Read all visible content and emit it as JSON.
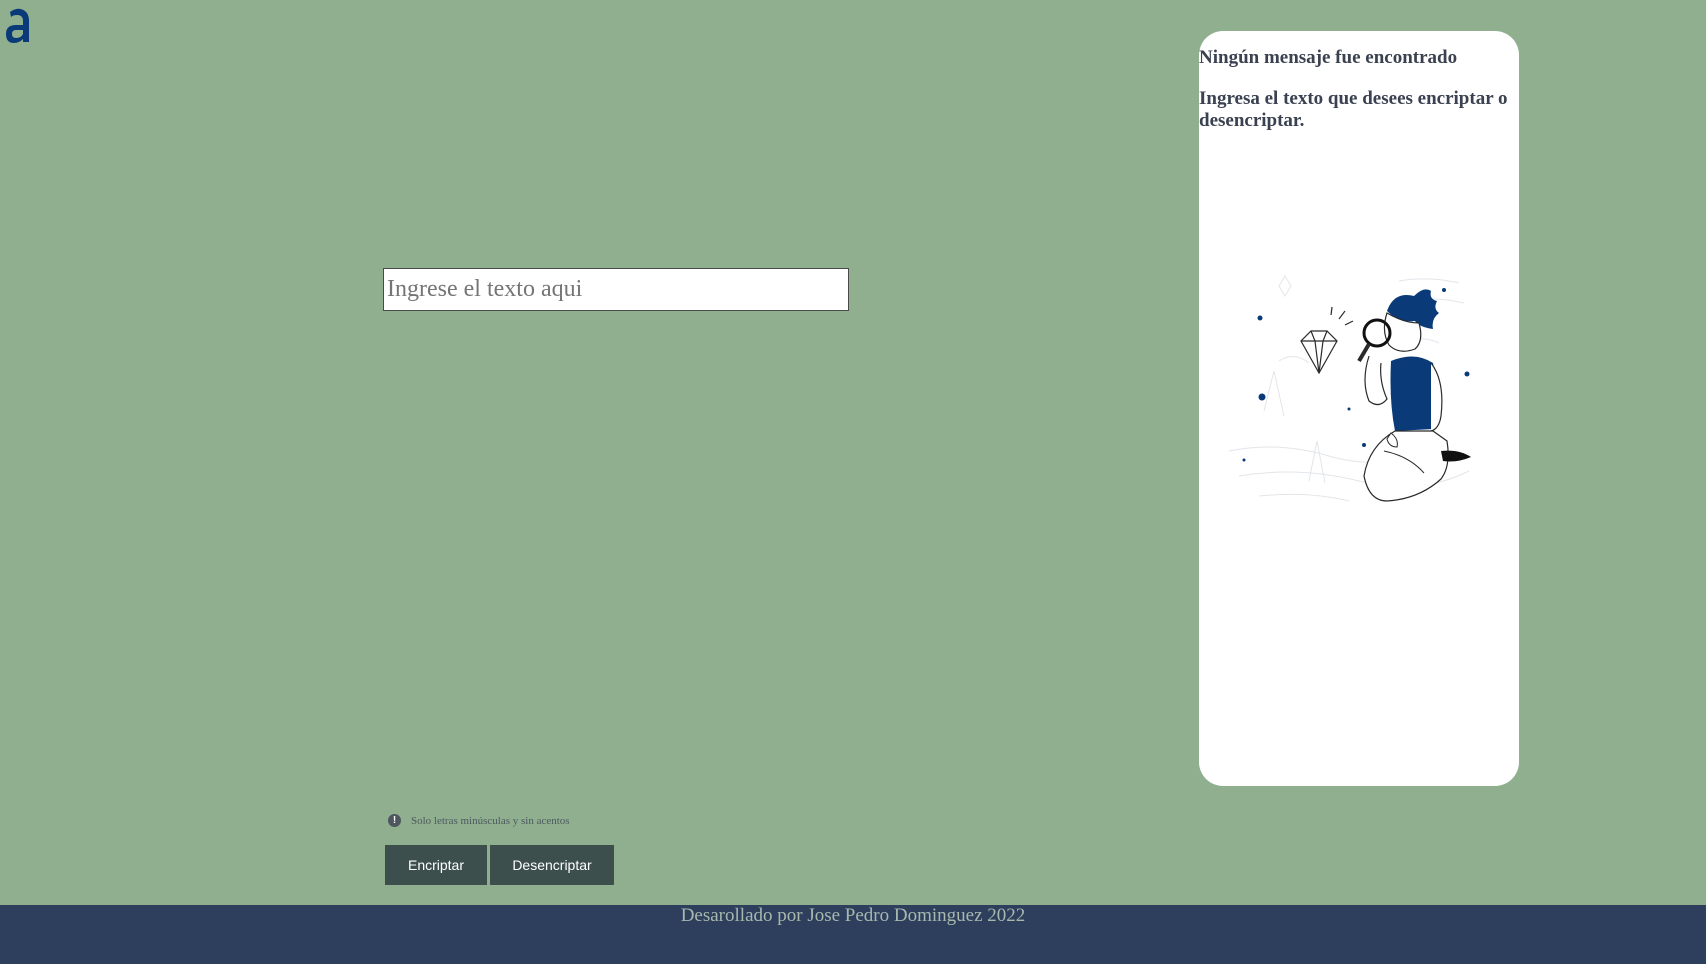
{
  "logo": {
    "icon": "alura-logo-icon",
    "color": "#0a3a78"
  },
  "input": {
    "placeholder": "Ingrese el texto aqui",
    "value": ""
  },
  "output_panel": {
    "title": "Ningún mensaje fue encontrado",
    "subtitle": "Ingresa el texto que desees encriptar o desencriptar.",
    "illustration": "person-with-magnifier-illustration"
  },
  "hint": {
    "icon": "exclamation-circle-icon",
    "text": "Solo letras minúsculas y sin acentos"
  },
  "buttons": {
    "encrypt_label": "Encriptar",
    "decrypt_label": "Desencriptar"
  },
  "footer": {
    "text": "Desarollado por Jose Pedro Dominguez 2022"
  },
  "colors": {
    "background": "#8faf8e",
    "panel": "#ffffff",
    "button": "#3c4f4d",
    "footer": "#2d3f5c",
    "accent": "#0a3a78"
  }
}
